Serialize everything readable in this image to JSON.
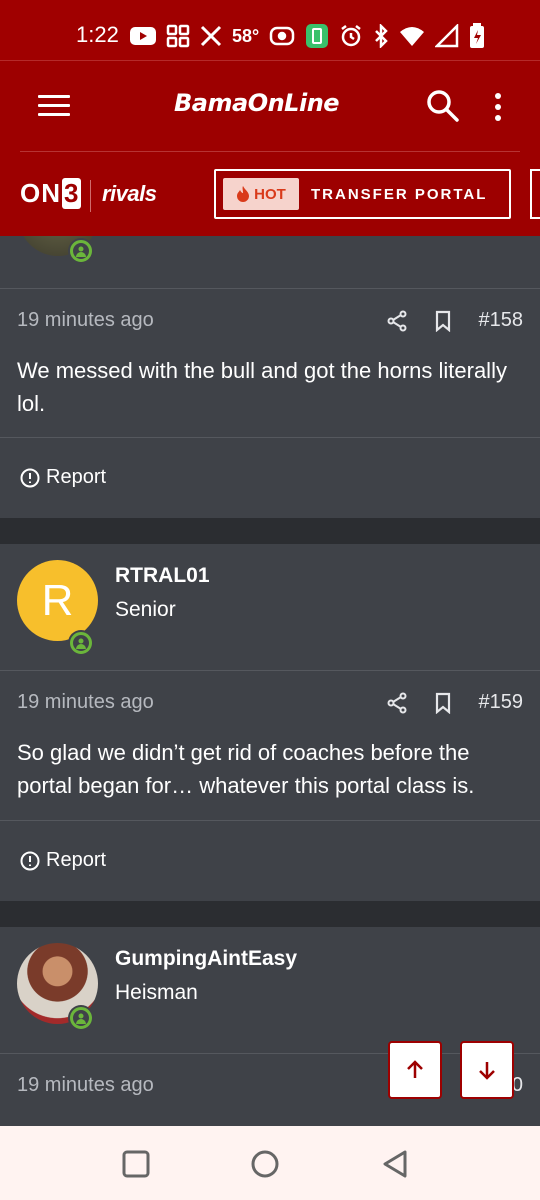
{
  "status_bar": {
    "time": "1:22",
    "temperature": "58°",
    "icons": [
      "youtube-icon",
      "grid-app-icon",
      "x-icon",
      "temperature",
      "hotspot-icon",
      "battery-saver-icon",
      "alarm-icon",
      "bluetooth-icon",
      "wifi-icon",
      "signal-icon",
      "battery-icon"
    ]
  },
  "header": {
    "brand": "BamaOnLine",
    "menu_icon": "hamburger-icon",
    "search_icon": "search-icon",
    "more_icon": "more-vertical-icon"
  },
  "brand_strip": {
    "on3_label": "ON",
    "on3_num": "3",
    "rivals_label": "rivals",
    "hot_label": "HOT",
    "portal_label": "TRANSFER PORTAL"
  },
  "posts": [
    {
      "time": "19 minutes ago",
      "number": "#158",
      "body": "We messed with the bull and got the horns literally lol.",
      "report_label": "Report"
    },
    {
      "username": "RTRAL01",
      "rank": "Senior",
      "avatar_letter": "R",
      "avatar_color": "#f7bf2c",
      "time": "19 minutes ago",
      "number": "#159",
      "body": "So glad we didn’t get rid of coaches before the portal began for… whatever this portal class is.",
      "report_label": "Report"
    },
    {
      "username": "GumpingAintEasy",
      "rank": "Heisman",
      "time": "19 minutes ago",
      "number_partial": "0"
    }
  ],
  "colors": {
    "brand_red": "#9d0000",
    "card_bg": "#3f4248",
    "online_green": "#6bb63b",
    "hot_red": "#d93a1a"
  }
}
